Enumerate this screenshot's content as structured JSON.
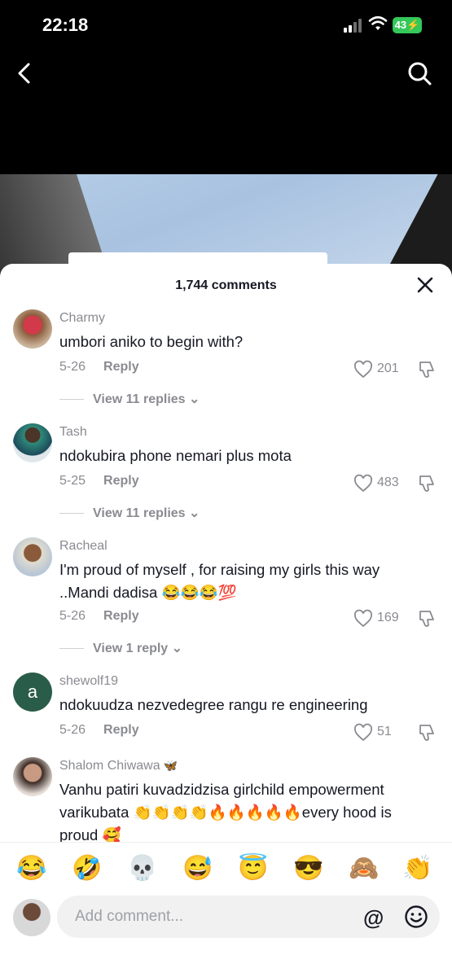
{
  "status_bar": {
    "time": "22:18",
    "battery": "43"
  },
  "comments_sheet": {
    "count_label": "1,744 comments",
    "comments": [
      {
        "username": "Charmy",
        "text": "umbori aniko to begin with?",
        "date": "5-26",
        "reply_label": "Reply",
        "likes": "201",
        "replies_label": "View 11 replies"
      },
      {
        "username": "Tash",
        "text": "ndokubira phone nemari plus mota",
        "date": "5-25",
        "reply_label": "Reply",
        "likes": "483",
        "replies_label": "View 11 replies"
      },
      {
        "username": "Racheal",
        "text": "I'm proud of myself , for raising my girls this way ..Mandi dadisa 😂😂😂💯",
        "date": "5-26",
        "reply_label": "Reply",
        "likes": "169",
        "replies_label": "View 1 reply"
      },
      {
        "username": "shewolf19",
        "avatar_letter": "a",
        "text": "ndokuudza nezvedegree rangu re engineering",
        "date": "5-26",
        "reply_label": "Reply",
        "likes": "51"
      },
      {
        "username": "Shalom Chiwawa",
        "badge": "🦋",
        "text": "Vanhu patiri kuvadzidzisa girlchild empowerment varikubata 👏👏👏👏🔥🔥🔥🔥🔥every hood is proud 🥰"
      }
    ]
  },
  "emoji_bar": [
    "😂",
    "🤣",
    "💀",
    "😅",
    "😇",
    "😎",
    "🙈",
    "👏"
  ],
  "composer": {
    "placeholder": "Add comment...",
    "at_symbol": "@"
  }
}
